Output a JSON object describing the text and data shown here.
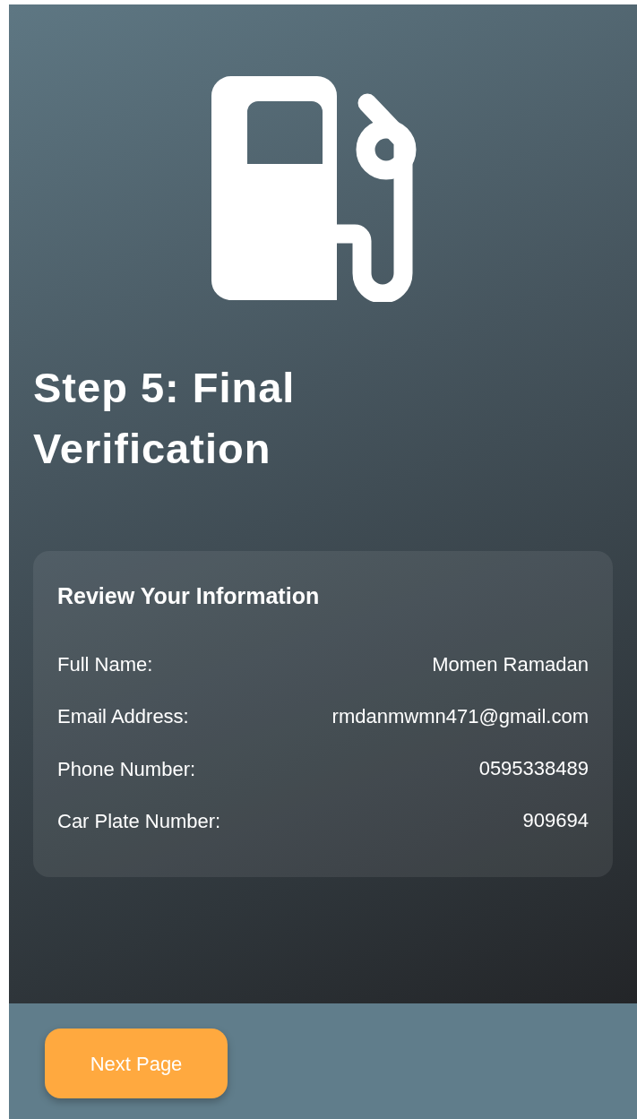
{
  "title": "Step 5: Final Verification",
  "card": {
    "heading": "Review Your Information",
    "rows": [
      {
        "label": "Full Name:",
        "value": "Momen Ramadan"
      },
      {
        "label": "Email Address:",
        "value": "rmdanmwmn471@gmail.com"
      },
      {
        "label": "Phone Number:",
        "value": "0595338489"
      },
      {
        "label": "Car Plate Number:",
        "value": "909694"
      }
    ]
  },
  "buttons": [
    {
      "label": "Next Page"
    }
  ]
}
